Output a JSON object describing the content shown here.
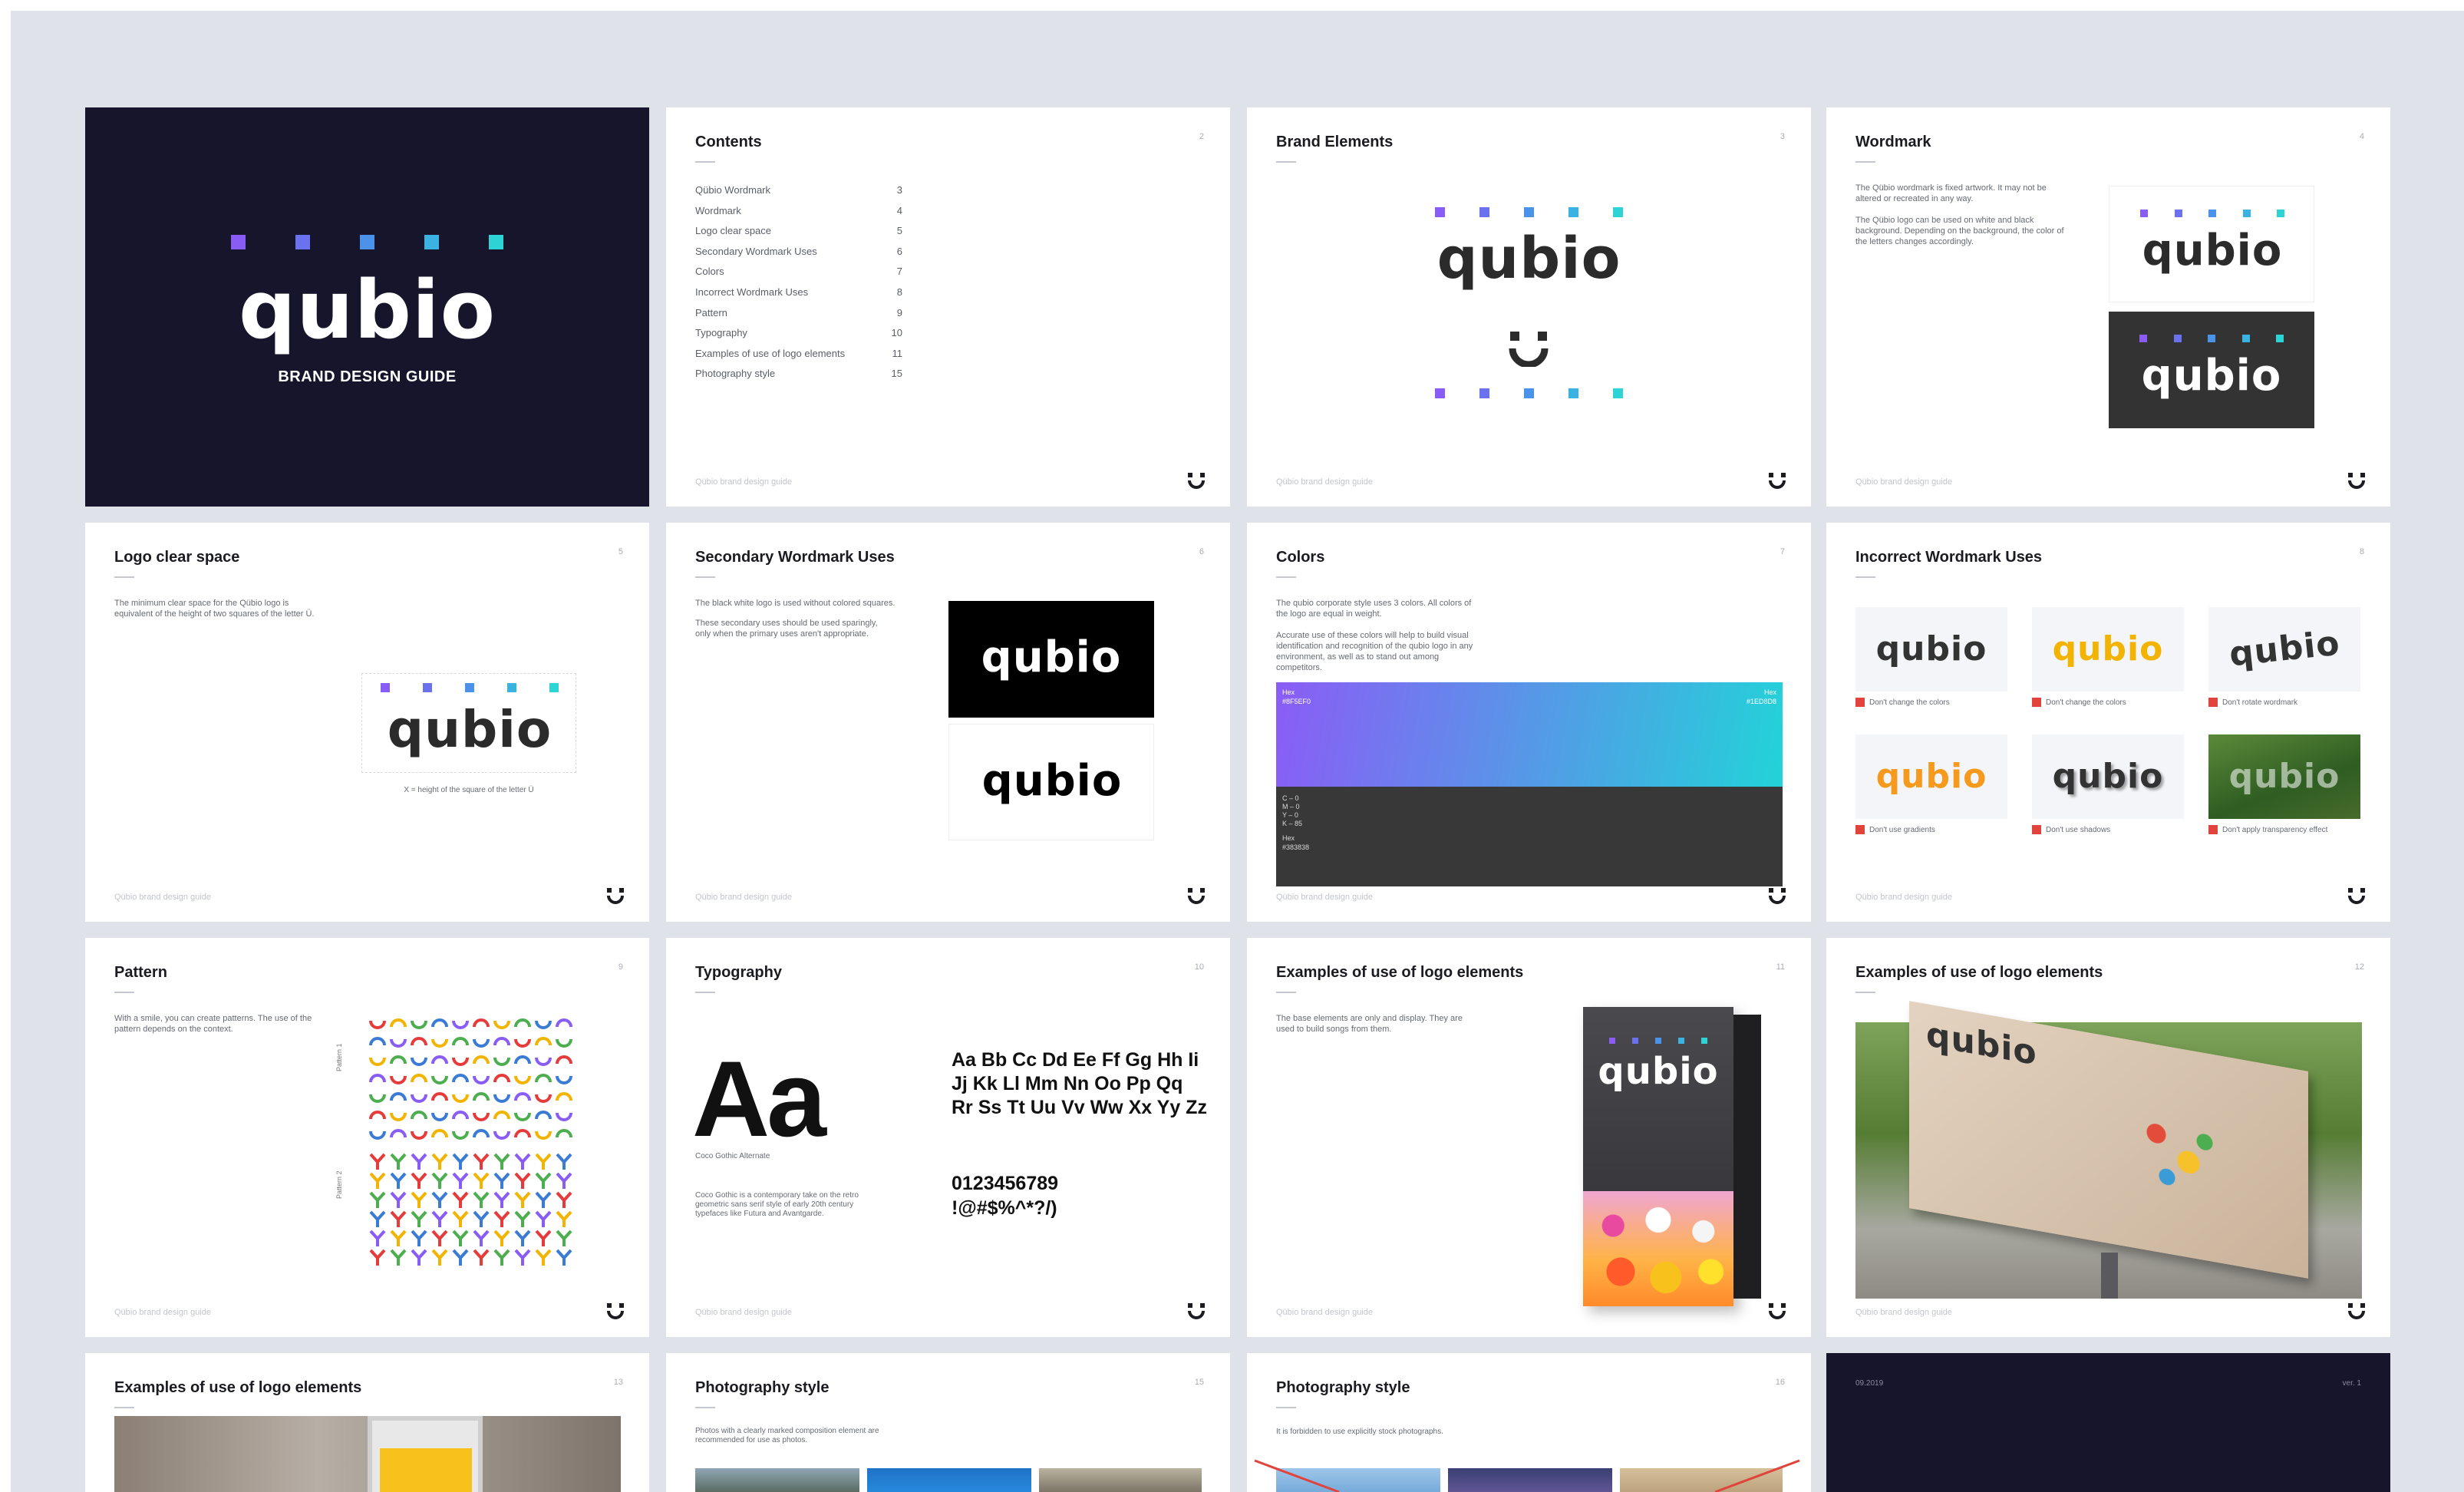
{
  "brand": {
    "name": "qubio",
    "tagline": "BRAND DESIGN GUIDE",
    "footer": "Qübio brand design guide",
    "dot_colors": [
      "#8a5cf6",
      "#6b72f0",
      "#4b93ea",
      "#3ab3e2",
      "#2ed3d6"
    ]
  },
  "slides": {
    "contents": {
      "title": "Contents",
      "page": "2",
      "items": [
        {
          "label": "Qübio Wordmark",
          "page": "3"
        },
        {
          "label": "Wordmark",
          "page": "4"
        },
        {
          "label": "Logo clear space",
          "page": "5"
        },
        {
          "label": "Secondary Wordmark Uses",
          "page": "6"
        },
        {
          "label": "Colors",
          "page": "7"
        },
        {
          "label": "Incorrect Wordmark Uses",
          "page": "8"
        },
        {
          "label": "Pattern",
          "page": "9"
        },
        {
          "label": "Typography",
          "page": "10"
        },
        {
          "label": "Examples of use of logo elements",
          "page": "11"
        },
        {
          "label": "Photography style",
          "page": "15"
        }
      ]
    },
    "brand_elements": {
      "title": "Brand Elements",
      "page": "3"
    },
    "wordmark": {
      "title": "Wordmark",
      "page": "4",
      "text1": "The Qübio wordmark is fixed artwork. It may not be altered or recreated in any way.",
      "text2": "The Qübio logo can be used on white and black background. Depending on the background, the color of the letters changes accordingly."
    },
    "clear_space": {
      "title": "Logo clear space",
      "page": "5",
      "text": "The minimum clear space for the Qübio logo is equivalent of the height of two squares of the letter Ü.",
      "caption": "X = height of the square of the letter Ü"
    },
    "secondary": {
      "title": "Secondary Wordmark Uses",
      "page": "6",
      "text1": "The black white logo is used without colored squares.",
      "text2": "These secondary uses should be used sparingly, only when the primary uses aren't appropriate."
    },
    "colors": {
      "title": "Colors",
      "page": "7",
      "text1": "The qubio corporate style uses 3 colors. All colors of the logo are equal in weight.",
      "text2": "Accurate use of these colors will help to build visual identification and recognition of the qubio logo in any environment, as well as to stand out among competitors.",
      "grad_left_label": "Hex",
      "grad_left_value": "#8F5EF0",
      "grad_right_label": "Hex",
      "grad_right_value": "#1ED8D8",
      "dark_values": "C – 0\nM – 0\nY – 0\nK – 85",
      "dark_hex_label": "Hex",
      "dark_hex": "#383838",
      "gradient_start": "#8b5cf6",
      "gradient_end": "#22d3d8",
      "dark": "#383838"
    },
    "incorrect": {
      "title": "Incorrect Wordmark Uses",
      "page": "8",
      "captions": [
        "Don't change the colors",
        "Don't change the colors",
        "Don't rotate wordmark",
        "Don't use gradients",
        "Don't use shadows",
        "Don't apply transparency effect"
      ]
    },
    "pattern": {
      "title": "Pattern",
      "page": "9",
      "text": "With a smile, you can create patterns. The use of the pattern depends on the context.",
      "label1": "Pattern 1",
      "label2": "Pattern 2"
    },
    "typography": {
      "title": "Typography",
      "page": "10",
      "sample_big": "Aa",
      "font_name": "Coco Gothic Alternate",
      "desc": "Coco Gothic is a contemporary take on the retro geometric sans serif style of early 20th century typefaces like Futura and Avantgarde.",
      "alphabet": "Aa Bb Cc Dd Ee Ff Gg Hh Ii Jj Kk Ll Mm Nn Oo Pp Qq Rr Ss Tt Uu Vv Ww Xx Yy Zz",
      "digits": "0123456789",
      "symbols": "!@#$%^*?/)"
    },
    "examples1": {
      "title": "Examples of use of logo elements",
      "page": "11",
      "text": "The base elements are only and display. They are used to build songs from them."
    },
    "examples2": {
      "title": "Examples of use of logo elements",
      "page": "12"
    },
    "examples3": {
      "title": "Examples of use of logo elements",
      "page": "13"
    },
    "photo1": {
      "title": "Photography style",
      "page": "15",
      "text": "Photos with a clearly marked composition element are recommended for use as photos."
    },
    "photo2": {
      "title": "Photography style",
      "page": "16",
      "text": "It is forbidden to use explicitly stock photographs."
    },
    "end": {
      "left": "09.2019",
      "right": "ver. 1"
    }
  }
}
